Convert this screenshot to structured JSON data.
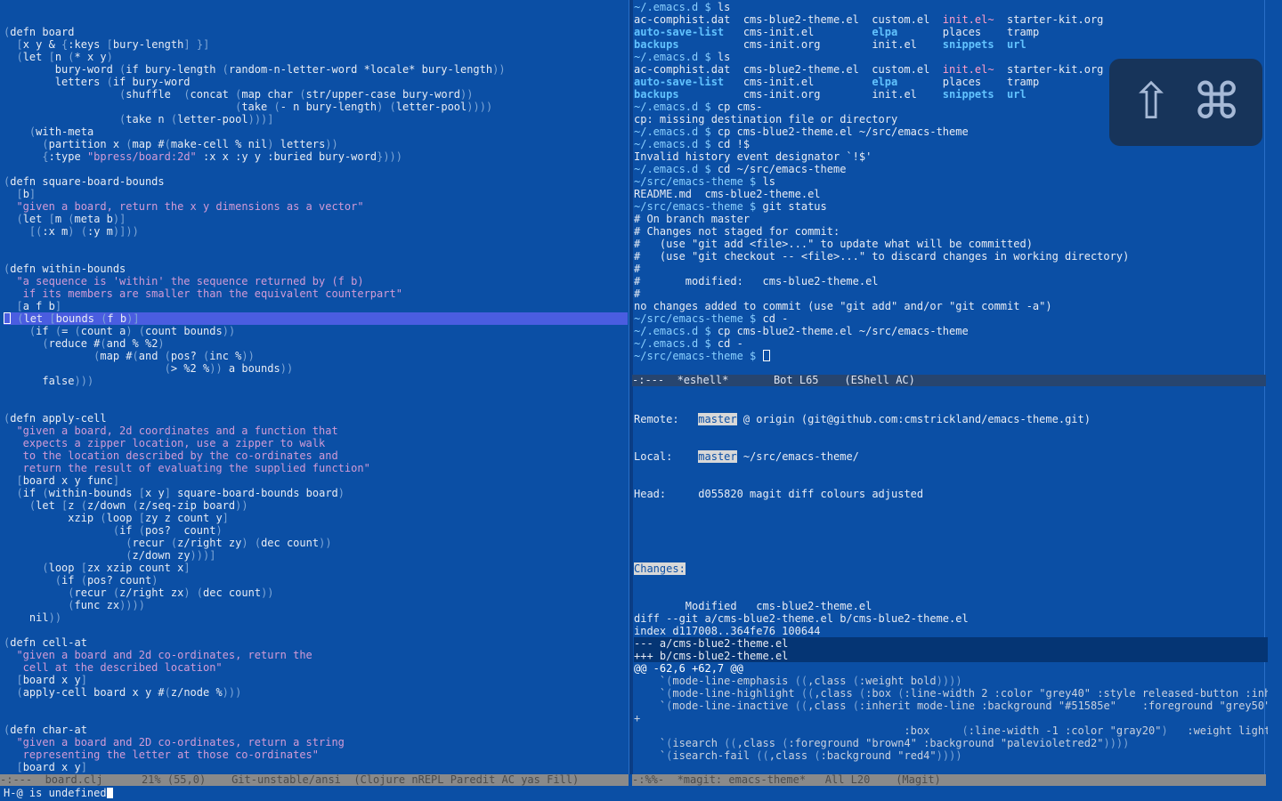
{
  "left_buffer": {
    "lines": [
      "(defn board",
      "  [x y & {:keys [bury-length] }]",
      "  (let [n (* x y)",
      "        bury-word (if bury-length (random-n-letter-word *locale* bury-length))",
      "        letters (if bury-word",
      "                  (shuffle  (concat (map char (str/upper-case bury-word))",
      "                                    (take (- n bury-length) (letter-pool))))",
      "                  (take n (letter-pool)))]",
      "    (with-meta",
      "      (partition x (map #(make-cell % nil) letters))",
      "      {:type \"bpress/board:2d\" :x x :y y :buried bury-word})))",
      "",
      "(defn square-board-bounds",
      "  [b]",
      "  \"given a board, return the x y dimensions as a vector\"",
      "  (let [m (meta b)]",
      "    [(:x m) (:y m)]))",
      "",
      "",
      "(defn within-bounds",
      "  \"a sequence is 'within' the sequence returned by (f b)",
      "   if its members are smaller than the equivalent counterpart\"",
      "  [a f b]",
      "  (let [bounds (f b)]",
      "    (if (= (count a) (count bounds))",
      "      (reduce #(and % %2)",
      "              (map #(and (pos? (inc %))",
      "                         (> %2 %)) a bounds))",
      "      false)))",
      "",
      "",
      "(defn apply-cell",
      "  \"given a board, 2d coordinates and a function that",
      "   expects a zipper location, use a zipper to walk",
      "   to the location described by the co-ordinates and",
      "   return the result of evaluating the supplied function\"",
      "  [board x y func]",
      "  (if (within-bounds [x y] square-board-bounds board)",
      "    (let [z (z/down (z/seq-zip board))",
      "          xzip (loop [zy z count y]",
      "                 (if (pos?  count)",
      "                   (recur (z/right zy) (dec count))",
      "                   (z/down zy)))]",
      "      (loop [zx xzip count x]",
      "        (if (pos? count)",
      "          (recur (z/right zx) (dec count))",
      "          (func zx))))",
      "    nil))",
      "",
      "(defn cell-at",
      "  \"given a board and 2d co-ordinates, return the",
      "   cell at the described location\"",
      "  [board x y]",
      "  (apply-cell board x y #(z/node %)))",
      "",
      "",
      "(defn char-at",
      "  \"given a board and 2D co-ordinates, return a string",
      "   representing the letter at those co-ordinates\"",
      "  [board x y]"
    ],
    "cursor_line_index": 23
  },
  "eshell": {
    "lines": [
      "~/.emacs.d $ ls",
      "ac-comphist.dat  cms-blue2-theme.el  custom.el  init.el~  starter-kit.org",
      "auto-save-list   cms-init.el         elpa       places    tramp",
      "backups          cms-init.org        init.el    snippets  url",
      "~/.emacs.d $ ls",
      "ac-comphist.dat  cms-blue2-theme.el  custom.el  init.el~  starter-kit.org",
      "auto-save-list   cms-init.el         elpa       places    tramp",
      "backups          cms-init.org        init.el    snippets  url",
      "~/.emacs.d $ cp cms-",
      "cp: missing destination file or directory",
      "~/.emacs.d $ cp cms-blue2-theme.el ~/src/emacs-theme",
      "~/.emacs.d $ cd !$",
      "Invalid history event designator `!$'",
      "~/.emacs.d $ cd ~/src/emacs-theme",
      "~/src/emacs-theme $ ls",
      "README.md  cms-blue2-theme.el",
      "~/src/emacs-theme $ git status",
      "# On branch master",
      "# Changes not staged for commit:",
      "#   (use \"git add <file>...\" to update what will be committed)",
      "#   (use \"git checkout -- <file>...\" to discard changes in working directory)",
      "#",
      "#       modified:   cms-blue2-theme.el",
      "#",
      "no changes added to commit (use \"git add\" and/or \"git commit -a\")",
      "~/src/emacs-theme $ cd -",
      "~/.emacs.d $ cp cms-blue2-theme.el ~/src/emacs-theme",
      "~/.emacs.d $ cd -",
      "~/src/emacs-theme $ "
    ],
    "modeline": "-:---  *eshell*       Bot L65    (EShell AC)"
  },
  "magit": {
    "remote_label": "Remote:",
    "remote_branch": "master",
    "remote_rest": " @ origin (git@github.com:cmstrickland/emacs-theme.git)",
    "local_label": "Local:",
    "local_branch": "master",
    "local_rest": " ~/src/emacs-theme/",
    "head_label": "Head:",
    "head_rest": "d055820 magit diff colours adjusted",
    "changes_label": "Changes:",
    "diff_lines": [
      "        Modified   cms-blue2-theme.el",
      "diff --git a/cms-blue2-theme.el b/cms-blue2-theme.el",
      "index d117008..364fe76 100644",
      "--- a/cms-blue2-theme.el",
      "+++ b/cms-blue2-theme.el",
      "@@ -62,6 +62,7 @@",
      "    `(mode-line-emphasis ((,class (:weight bold))))",
      "    `(mode-line-highlight ((,class (:box (:line-width 2 :color \"grey40\" :style released-button :inher",
      "    `(mode-line-inactive ((,class (:inherit mode-line :background \"#51585e\"    :foreground \"grey50\"",
      "+",
      "                                          :box     (:line-width -1 :color \"gray20\")   :weight light",
      "    `(isearch ((,class (:foreground \"brown4\" :background \"palevioletred2\"))))",
      "    `(isearch-fail ((,class (:background \"red4\"))))"
    ],
    "modeline": "-:%%-  *magit: emacs-theme*   All L20    (Magit)"
  },
  "left_modeline": "-:---  board.clj      21% (55,0)    Git-unstable/ansi  (Clojure nREPL Paredit AC yas Fill)",
  "minibuffer": "H-@ is undefined",
  "overlay": {
    "shift_glyph": "⇧",
    "command_glyph": "⌘"
  },
  "colors": {
    "background": "#0b4fa5",
    "cursor_line": "#4a5de0",
    "prompt": "#8ad0ff",
    "string": "#d29bd6"
  }
}
